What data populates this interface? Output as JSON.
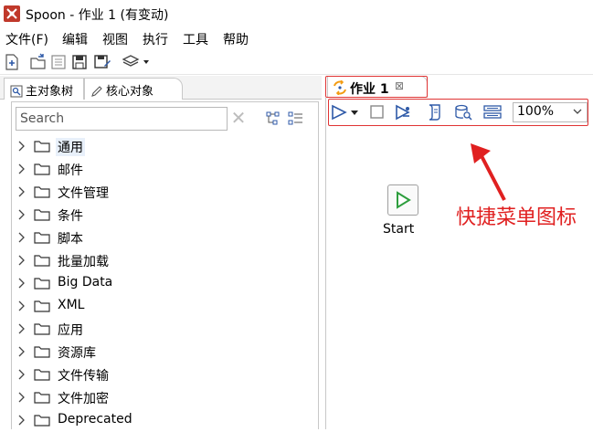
{
  "window": {
    "title": "Spoon - 作业 1 (有变动)"
  },
  "menubar": {
    "items": [
      "文件(F)",
      "编辑",
      "视图",
      "执行",
      "工具",
      "帮助"
    ]
  },
  "left_panel": {
    "tabs": [
      {
        "label": "主对象树",
        "icon": "tree-icon"
      },
      {
        "label": "核心对象",
        "icon": "pencil-icon"
      }
    ],
    "search": {
      "placeholder": "Search",
      "value": ""
    },
    "tree_items": [
      "通用",
      "邮件",
      "文件管理",
      "条件",
      "脚本",
      "批量加载",
      "Big Data",
      "XML",
      "应用",
      "资源库",
      "文件传输",
      "文件加密",
      "Deprecated"
    ],
    "selected_index": 0
  },
  "job_tab": {
    "label": "作业 1",
    "close_glyph": "⊠"
  },
  "job_toolbar": {
    "zoom": "100%"
  },
  "canvas": {
    "start_label": "Start",
    "annotation": "快捷菜单图标"
  },
  "colors": {
    "highlight": "#e03434",
    "annotation": "#e02020",
    "start_green": "#2e9e3e",
    "icon_blue": "#2f5aa8",
    "selection": "#e8f0fa"
  }
}
